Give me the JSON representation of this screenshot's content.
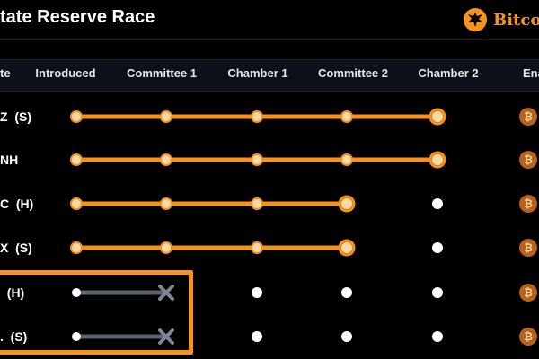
{
  "header": {
    "title": "tate Reserve Race",
    "brand": "Bitcoin"
  },
  "columns": [
    {
      "label": "te"
    },
    {
      "label": "Introduced"
    },
    {
      "label": "Committee 1"
    },
    {
      "label": "Chamber 1"
    },
    {
      "label": "Committee 2"
    },
    {
      "label": "Chamber 2"
    },
    {
      "label": "Ena"
    }
  ],
  "rows": [
    {
      "label": "Z  (S)",
      "reached": 4,
      "failed": false
    },
    {
      "label": "NH",
      "reached": 4,
      "failed": false
    },
    {
      "label": "C  (H)",
      "reached": 3,
      "failed": false
    },
    {
      "label": "X  (S)",
      "reached": 3,
      "failed": false
    },
    {
      "label": "  (H)",
      "reached": 1,
      "failed": true
    },
    {
      "label": ".  (S)",
      "reached": 1,
      "failed": true
    }
  ],
  "coin_glyph": "₿",
  "colors": {
    "accent": "#f7931a",
    "failed_track": "#5a6270",
    "pending_dot": "#ffffff",
    "coin": "#b5621c"
  },
  "icons": {
    "brand": "bitcoin-eagle-seal-icon",
    "failed": "x-mark-icon",
    "enacted": "bitcoin-coin-icon"
  }
}
